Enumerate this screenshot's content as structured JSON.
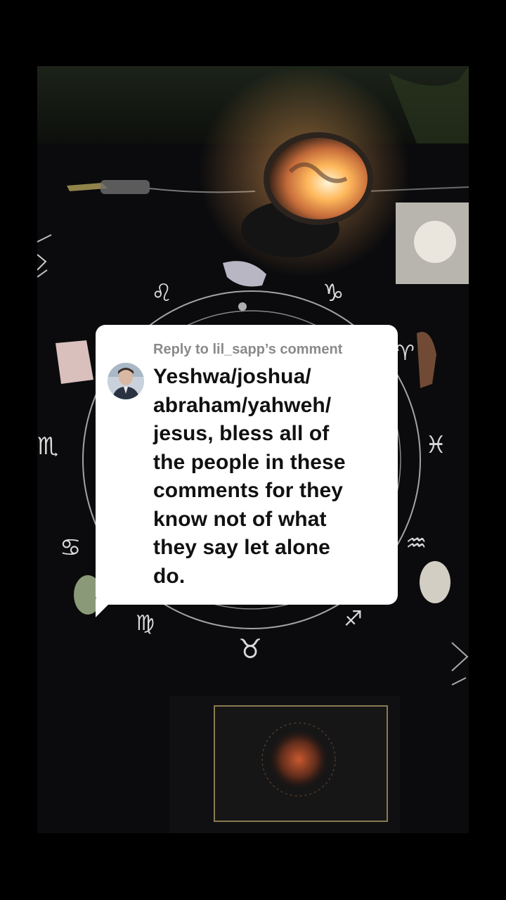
{
  "reply": {
    "header": "Reply to lil_sapp’s comment",
    "lines": [
      "Yeshwa/joshua/",
      "abraham/yahweh/",
      "jesus, bless all of",
      "the people in these",
      "comments for they",
      "know not of what",
      "they say let alone",
      "do."
    ]
  },
  "video": {
    "zodiac_glyphs": [
      "♌",
      "♑",
      "♈",
      "♏",
      "♓",
      "♋",
      "♒",
      "♍",
      "♐",
      "♉"
    ]
  },
  "colors": {
    "card_background": "#ffffff",
    "header_text": "#8a8a8a",
    "body_text": "#111111",
    "backdrop": "#000000"
  }
}
